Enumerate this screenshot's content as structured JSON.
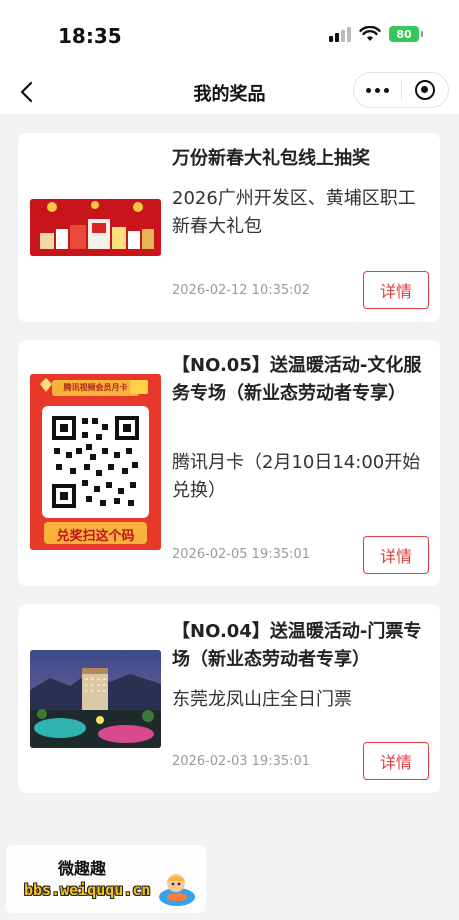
{
  "status_bar": {
    "time": "18:35",
    "battery": "80"
  },
  "nav": {
    "title": "我的奖品"
  },
  "prizes": [
    {
      "title": "万份新春大礼包线上抽奖",
      "desc": "2026广州开发区、黄埔区职工新春大礼包",
      "date": "2026-02-12 10:35:02",
      "detail_label": "详情"
    },
    {
      "title": "【NO.05】送温暖活动-文化服务专场（新业态劳动者专享）",
      "desc": "腾讯月卡（2月10日14:00开始兑换）",
      "date": "2026-02-05 19:35:01",
      "detail_label": "详情",
      "thumb_header": "腾讯视频会员月卡",
      "thumb_footer": "兑奖扫这个码"
    },
    {
      "title": "【NO.04】送温暖活动-门票专场（新业态劳动者专享）",
      "desc": "东莞龙凤山庄全日门票",
      "date": "2026-02-03 19:35:01",
      "detail_label": "详情"
    }
  ],
  "watermark": {
    "title": "微趣趣",
    "url": "bbs.weiququ.cn"
  },
  "colors": {
    "accent": "#e03c3c",
    "background": "#f2f2f4",
    "battery": "#34c759"
  }
}
